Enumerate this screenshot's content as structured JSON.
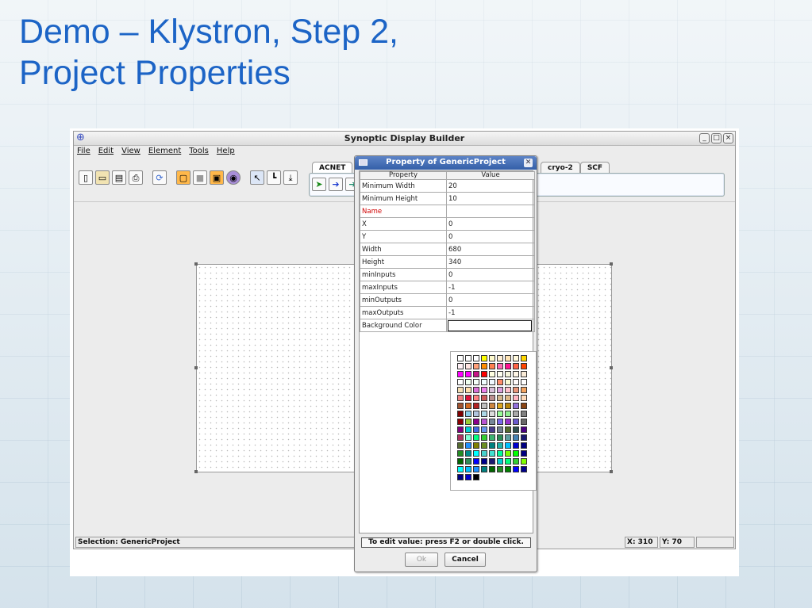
{
  "slide": {
    "title_line1": "Demo – Klystron, Step 2,",
    "title_line2": "Project Properties"
  },
  "window": {
    "title": "Synoptic Display Builder",
    "buttons": [
      "_",
      "□",
      "×"
    ]
  },
  "menu": [
    "File",
    "Edit",
    "View",
    "Element",
    "Tools",
    "Help"
  ],
  "toolbar_icons": [
    "new-file-icon",
    "open-folder-icon",
    "save-icon",
    "print-icon",
    "refresh-icon",
    "insert-icon",
    "camera-icon",
    "component-icon",
    "globe-icon",
    "arrow-select-icon",
    "connector-icon",
    "export-icon"
  ],
  "tabs": {
    "left": [
      "ACNET"
    ],
    "right": [
      "cryo-2",
      "SCF"
    ]
  },
  "palette_icons": [
    "green-arrow-icon",
    "blue-arrow-icon",
    "teal-arrow-icon"
  ],
  "status": {
    "selection": "Selection: GenericProject",
    "x": "X: 310",
    "y": "Y: 70"
  },
  "dialog": {
    "title": "Property of GenericProject",
    "headers": [
      "Property",
      "Value"
    ],
    "rows": [
      {
        "property": "Minimum Width",
        "value": "20"
      },
      {
        "property": "Minimum Height",
        "value": "10"
      },
      {
        "property": "Name",
        "value": "",
        "required": true
      },
      {
        "property": "X",
        "value": "0"
      },
      {
        "property": "Y",
        "value": "0"
      },
      {
        "property": "Width",
        "value": "680"
      },
      {
        "property": "Height",
        "value": "340"
      },
      {
        "property": "minInputs",
        "value": "0"
      },
      {
        "property": "maxInputs",
        "value": "-1"
      },
      {
        "property": "minOutputs",
        "value": "0"
      },
      {
        "property": "maxOutputs",
        "value": "-1"
      },
      {
        "property": "Background Color",
        "value": ""
      }
    ],
    "hint": "To edit value: press F2 or double click.",
    "ok_label": "Ok",
    "cancel_label": "Cancel"
  },
  "swatch_colors": [
    "#ffffff",
    "#ffffff",
    "#ffffff",
    "#ffff00",
    "#fffacd",
    "#ffefd5",
    "#ffe4b5",
    "#fff8dc",
    "#ffd700",
    "#fff0f5",
    "#ffe4e1",
    "#ffa07a",
    "#ff8c00",
    "#ff7f50",
    "#ff69b4",
    "#ff1493",
    "#ff6347",
    "#ff4500",
    "#ff00ff",
    "#ff00ff",
    "#c71585",
    "#ff0000",
    "#ffffe0",
    "#fffff0",
    "#f5f5dc",
    "#fdf5e6",
    "#faebd7",
    "#ffffff",
    "#f0fff0",
    "#f5fffa",
    "#f0ffff",
    "#f0f8ff",
    "#ff8c69",
    "#fafad2",
    "#fffafa",
    "#ffffff",
    "#f5deb3",
    "#ffdead",
    "#da70d6",
    "#ee82ee",
    "#d8bfd8",
    "#dda0dd",
    "#ffc0cb",
    "#e9967a",
    "#f4a460",
    "#f08080",
    "#dc143c",
    "#ff7f7f",
    "#cd5c5c",
    "#bc8f8f",
    "#d2b48c",
    "#deb887",
    "#ffb6c1",
    "#ffdab9",
    "#a0522d",
    "#d2691e",
    "#b22222",
    "#c0c0c0",
    "#cd853f",
    "#daa520",
    "#b8860b",
    "#9370db",
    "#8b4513",
    "#800000",
    "#87ceeb",
    "#b0c4de",
    "#add8e6",
    "#dcdcdc",
    "#98fb98",
    "#90ee90",
    "#a9a9a9",
    "#808080",
    "#8b0000",
    "#9acd32",
    "#8b008b",
    "#ba55d3",
    "#778899",
    "#7b68ee",
    "#9932cc",
    "#6a5acd",
    "#696969",
    "#800080",
    "#00ced1",
    "#4169e1",
    "#6495ed",
    "#483d8b",
    "#708090",
    "#556b2f",
    "#2f4f4f",
    "#4b0082",
    "#b03060",
    "#7fffd4",
    "#00ff7f",
    "#32cd32",
    "#3cb371",
    "#2e8b57",
    "#5f9ea0",
    "#4682b4",
    "#191970",
    "#556b2f",
    "#1e90ff",
    "#808000",
    "#6b8e23",
    "#008080",
    "#20b2aa",
    "#00bfff",
    "#0000cd",
    "#000080",
    "#228b22",
    "#008b8b",
    "#00ffff",
    "#48d1cc",
    "#40e0d0",
    "#00fa9a",
    "#7cfc00",
    "#00ff00",
    "#000080",
    "#006400",
    "#2e8b57",
    "#0000ff",
    "#00008b",
    "#191970",
    "#00ced1",
    "#00ff7f",
    "#32cd32",
    "#7fff00",
    "#00ffff",
    "#00bfff",
    "#1e90ff",
    "#008080",
    "#006400",
    "#228b22",
    "#008000",
    "#0000ff",
    "#00008b",
    "#000080",
    "#0000cd",
    "#000000"
  ]
}
